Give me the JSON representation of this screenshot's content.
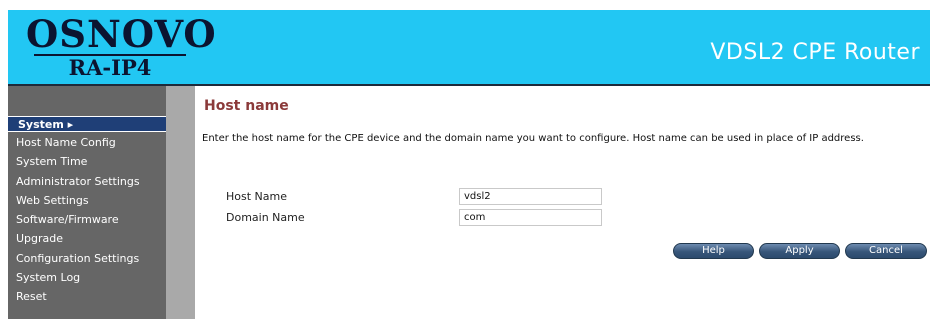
{
  "header": {
    "logo_brand": "OSNOVO",
    "logo_model": "RA-IP4",
    "product_title": "VDSL2 CPE Router"
  },
  "sidebar": {
    "active": "System",
    "active_arrow": "▸",
    "items": [
      {
        "label": "Host Name Config"
      },
      {
        "label": "System Time"
      },
      {
        "label": "Administrator Settings"
      },
      {
        "label": "Web Settings"
      },
      {
        "label": "Software/Firmware"
      },
      {
        "label": "Upgrade"
      },
      {
        "label": "Configuration Settings"
      },
      {
        "label": "System Log"
      },
      {
        "label": "Reset"
      }
    ]
  },
  "content": {
    "title": "Host name",
    "description": "Enter the host name for the CPE device and the domain name you want to configure. Host name can be used in place of IP address.",
    "fields": {
      "host_name": {
        "label": "Host Name",
        "value": "vdsl2"
      },
      "domain_name": {
        "label": "Domain Name",
        "value": "com"
      }
    }
  },
  "buttons": {
    "help": "Help",
    "apply": "Apply",
    "cancel": "Cancel"
  },
  "colors": {
    "header_bg": "#22c7f3",
    "sidebar_bg": "#666666",
    "active_item_bg": "#1f3f77",
    "title_color": "#8b3a3a",
    "button_bg": "#375679"
  }
}
